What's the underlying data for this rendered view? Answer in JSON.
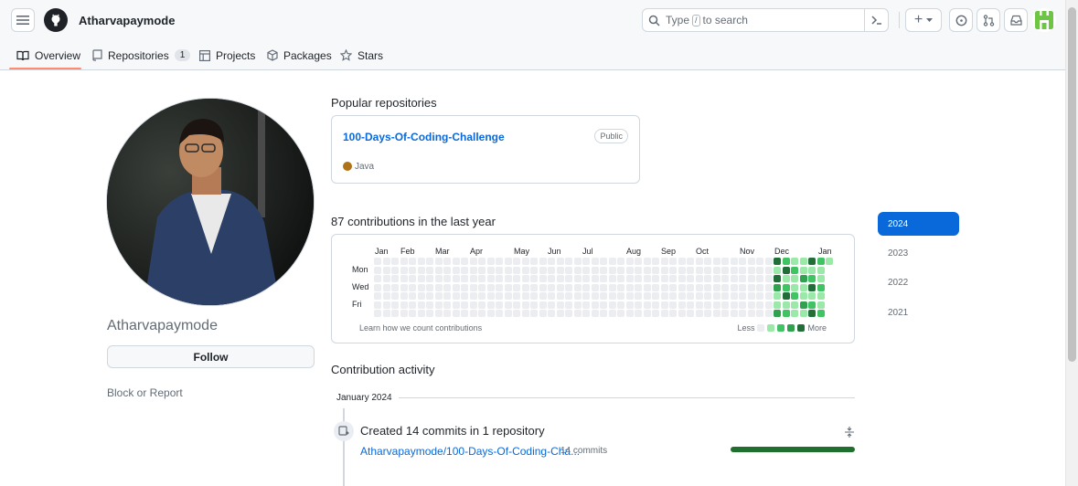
{
  "header": {
    "username": "Atharvapaymode",
    "search": {
      "pre": "Type",
      "key": "/",
      "post": "to search"
    },
    "plus_label": "+"
  },
  "tabs": [
    {
      "label": "Overview"
    },
    {
      "label": "Repositories",
      "count": "1"
    },
    {
      "label": "Projects"
    },
    {
      "label": "Packages"
    },
    {
      "label": "Stars"
    }
  ],
  "profile": {
    "name": "Atharvapaymode",
    "follow_label": "Follow",
    "block_label": "Block or Report"
  },
  "popular": {
    "title": "Popular repositories",
    "repo": {
      "name": "100-Days-Of-Coding-Challenge",
      "visibility": "Public",
      "language": "Java"
    }
  },
  "contributions": {
    "title": "87 contributions in the last year",
    "months": [
      "Jan",
      "Feb",
      "Mar",
      "Apr",
      "May",
      "Jun",
      "Jul",
      "Aug",
      "Sep",
      "Oct",
      "Nov",
      "Dec",
      "Jan"
    ],
    "days": [
      "Mon",
      "Wed",
      "Fri"
    ],
    "learn_label": "Learn how we count contributions",
    "less_label": "Less",
    "more_label": "More",
    "colors": [
      "#ebedf0",
      "#9be9a8",
      "#40c463",
      "#30a14e",
      "#216e39"
    ]
  },
  "years": [
    "2024",
    "2023",
    "2022",
    "2021"
  ],
  "activity": {
    "title": "Contribution activity",
    "month": "January 2024",
    "summary": "Created 14 commits in 1 repository",
    "repo_link": "Atharvapaymode/100-Days-Of-Coding-Cha...",
    "commits": "14 commits"
  }
}
